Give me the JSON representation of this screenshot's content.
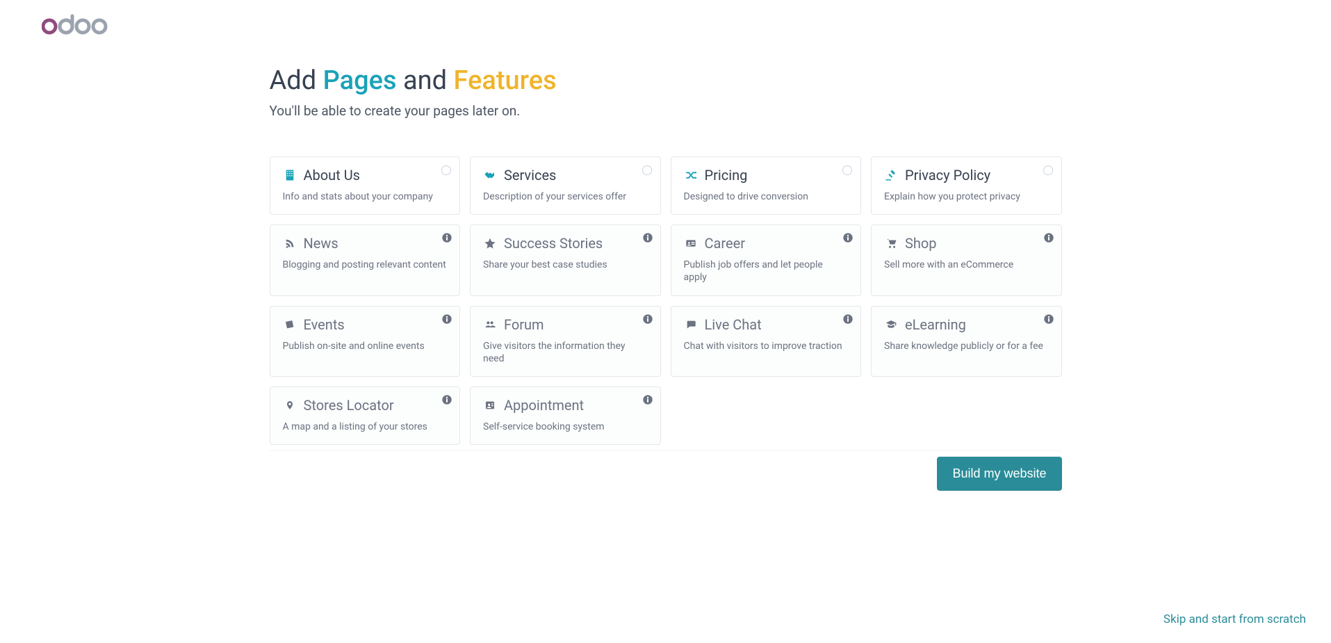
{
  "brand": "odoo",
  "heading": {
    "part1": "Add ",
    "pages": "Pages",
    "part2": " and ",
    "features": "Features"
  },
  "subtitle": "You'll be able to create your pages later on.",
  "cards": [
    {
      "id": "about-us",
      "title": "About Us",
      "desc": "Info and stats about your company",
      "icon": "building",
      "iconColor": "#1aa2b8",
      "badge": "select",
      "muted": false
    },
    {
      "id": "services",
      "title": "Services",
      "desc": "Description of your services offer",
      "icon": "handshake",
      "iconColor": "#1aa2b8",
      "badge": "select",
      "muted": false
    },
    {
      "id": "pricing",
      "title": "Pricing",
      "desc": "Designed to drive conversion",
      "icon": "shuffle",
      "iconColor": "#1aa2b8",
      "badge": "select",
      "muted": false
    },
    {
      "id": "privacy-policy",
      "title": "Privacy Policy",
      "desc": "Explain how you protect privacy",
      "icon": "gavel",
      "iconColor": "#1aa2b8",
      "badge": "select",
      "muted": false
    },
    {
      "id": "news",
      "title": "News",
      "desc": "Blogging and posting relevant content",
      "icon": "rss",
      "iconColor": "#6b7280",
      "badge": "info",
      "muted": true
    },
    {
      "id": "success-stories",
      "title": "Success Stories",
      "desc": "Share your best case studies",
      "icon": "star",
      "iconColor": "#6b7280",
      "badge": "info",
      "muted": true
    },
    {
      "id": "career",
      "title": "Career",
      "desc": "Publish job offers and let people apply",
      "icon": "idcard",
      "iconColor": "#6b7280",
      "badge": "info",
      "muted": true
    },
    {
      "id": "shop",
      "title": "Shop",
      "desc": "Sell more with an eCommerce",
      "icon": "cart",
      "iconColor": "#6b7280",
      "badge": "info",
      "muted": true
    },
    {
      "id": "events",
      "title": "Events",
      "desc": "Publish on-site and online events",
      "icon": "ticket",
      "iconColor": "#6b7280",
      "badge": "info",
      "muted": true
    },
    {
      "id": "forum",
      "title": "Forum",
      "desc": "Give visitors the information they need",
      "icon": "users",
      "iconColor": "#6b7280",
      "badge": "info",
      "muted": true
    },
    {
      "id": "live-chat",
      "title": "Live Chat",
      "desc": "Chat with visitors to improve traction",
      "icon": "chat",
      "iconColor": "#6b7280",
      "badge": "info",
      "muted": true
    },
    {
      "id": "elearning",
      "title": "eLearning",
      "desc": "Share knowledge publicly or for a fee",
      "icon": "gradcap",
      "iconColor": "#6b7280",
      "badge": "info",
      "muted": true
    },
    {
      "id": "stores-locator",
      "title": "Stores Locator",
      "desc": "A map and a listing of your stores",
      "icon": "pin",
      "iconColor": "#6b7280",
      "badge": "info",
      "muted": true
    },
    {
      "id": "appointment",
      "title": "Appointment",
      "desc": "Self-service booking system",
      "icon": "addressbook",
      "iconColor": "#6b7280",
      "badge": "info",
      "muted": true
    }
  ],
  "buildButton": "Build my website",
  "skipLink": "Skip and start from scratch"
}
